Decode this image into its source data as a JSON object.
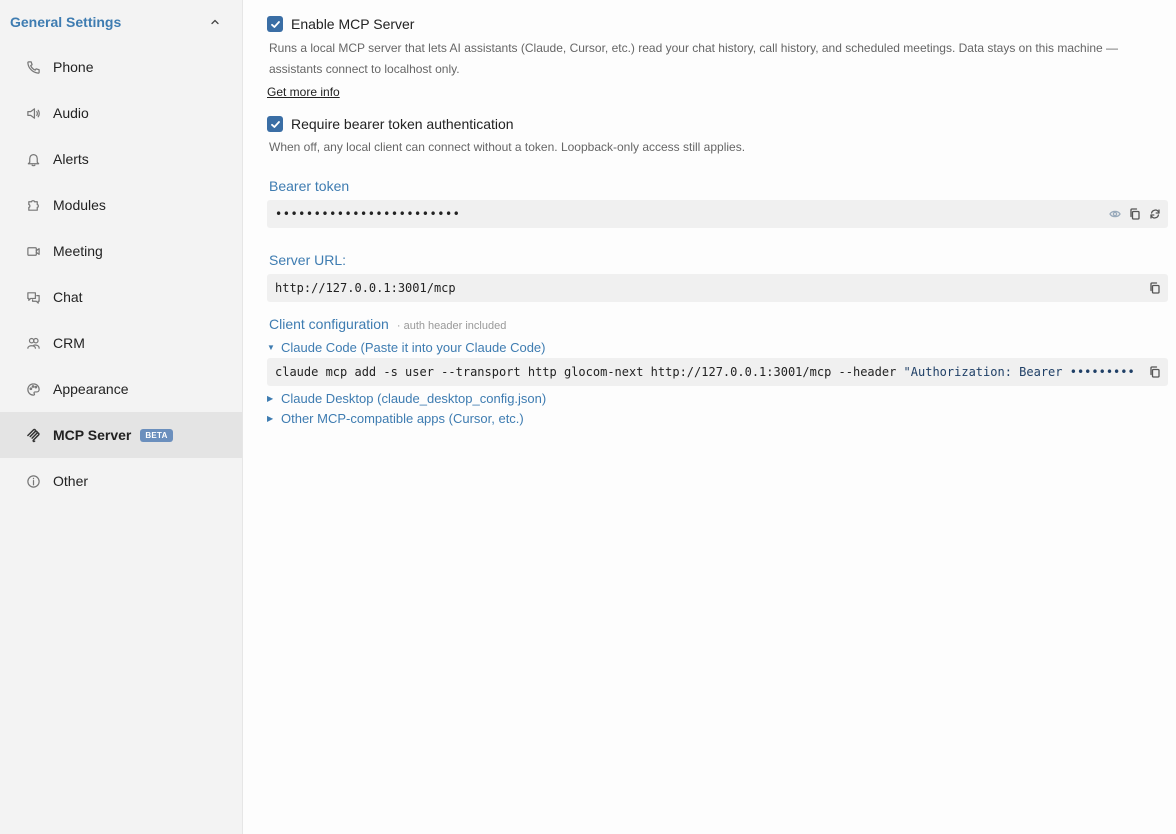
{
  "sidebar": {
    "title": "General Settings",
    "items": [
      {
        "label": "Phone",
        "icon": "phone-icon"
      },
      {
        "label": "Audio",
        "icon": "speaker-icon"
      },
      {
        "label": "Alerts",
        "icon": "bell-icon"
      },
      {
        "label": "Modules",
        "icon": "puzzle-icon"
      },
      {
        "label": "Meeting",
        "icon": "video-icon"
      },
      {
        "label": "Chat",
        "icon": "chat-icon"
      },
      {
        "label": "CRM",
        "icon": "contacts-icon"
      },
      {
        "label": "Appearance",
        "icon": "palette-icon"
      },
      {
        "label": "MCP Server",
        "icon": "mcp-icon",
        "badge": "BETA",
        "active": true
      },
      {
        "label": "Other",
        "icon": "info-icon"
      }
    ]
  },
  "main": {
    "enable_mcp": {
      "label": "Enable MCP Server",
      "checked": true
    },
    "enable_desc": "Runs a local MCP server that lets AI assistants (Claude, Cursor, etc.) read your chat history, call history, and scheduled meetings. Data stays on this machine — assistants connect to localhost only.",
    "more_info": "Get more info",
    "require_token": {
      "label": "Require bearer token authentication",
      "checked": true
    },
    "require_desc": "When off, any local client can connect without a token. Loopback-only access still applies.",
    "bearer_label": "Bearer token",
    "bearer_value": "••••••••••••••••••••••••",
    "server_url_label": "Server URL:",
    "server_url": "http://127.0.0.1:3001/mcp",
    "client_config_label": "Client configuration",
    "client_config_note": "· auth header included",
    "claude_code": {
      "label": "Claude Code (Paste it into your Claude Code)",
      "command": "claude mcp add -s user --transport http glocom-next http://127.0.0.1:3001/mcp --header ",
      "command_str": "\"Authorization: Bearer •••••••••"
    },
    "claude_desktop": "Claude Desktop (claude_desktop_config.json)",
    "other_apps": "Other MCP-compatible apps (Cursor, etc.)"
  },
  "colors": {
    "accent": "#3e7cb1",
    "checkbox": "#3a6ea5",
    "badge": "#6b8fbd"
  }
}
